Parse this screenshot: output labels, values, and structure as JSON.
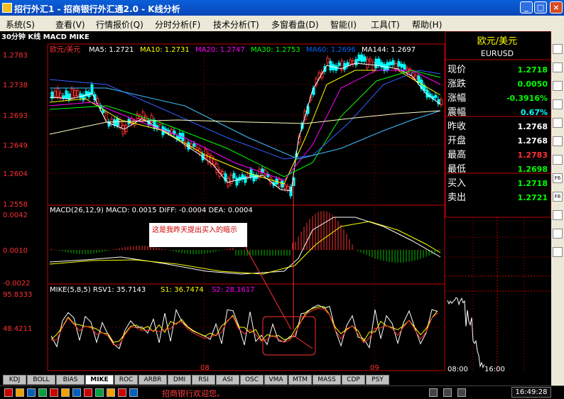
{
  "window": {
    "title": "招行外汇1 - 招商银行外汇通2.0 - K线分析",
    "controls": [
      "_",
      "□",
      "×"
    ]
  },
  "menu": [
    "系统(S)",
    "查看(V)",
    "行情报价(Q)",
    "分时分析(F)",
    "技术分析(T)",
    "多窗看盘(D)",
    "智能(I)",
    "工具(T)",
    "帮助(H)"
  ],
  "chart_header": "30分钟 K线 MACD MIKE",
  "main_chart": {
    "symbol": "欧元/美元",
    "ma": [
      {
        "label": "MA5: 1.2721",
        "color": "#ffffff"
      },
      {
        "label": "MA10: 1.2731",
        "color": "#ffff00"
      },
      {
        "label": "MA20: 1.2747",
        "color": "#ff00ff"
      },
      {
        "label": "MA30: 1.2753",
        "color": "#00ff00"
      },
      {
        "label": "MA60: 1.2696",
        "color": "#0066ff"
      },
      {
        "label": "MA144: 1.2697",
        "color": "#ffffff"
      }
    ],
    "y_ticks": [
      "1.2783",
      "1.2738",
      "1.2693",
      "1.2649",
      "1.2604",
      "1.2558"
    ]
  },
  "macd_chart": {
    "header": "MACD(26,12,9) MACD: 0.0015 DIFF: -0.0004 DEA: 0.0004",
    "y_ticks": [
      "0.0042",
      "0.0010",
      "-0.0022"
    ]
  },
  "mike_chart": {
    "header_items": [
      {
        "text": "MIKE(5,8,5) RSV1: 35.7143",
        "color": "#ffffff"
      },
      {
        "text": "S1: 36.7474",
        "color": "#ffff00"
      },
      {
        "text": "S2: 28.1617",
        "color": "#ff00ff"
      }
    ],
    "y_ticks": [
      "95.8333",
      "48.4211"
    ]
  },
  "x_labels": [
    "08",
    "09"
  ],
  "annotation": "这是我昨天提出买入的暗示",
  "quote_panel": {
    "name": "欧元/美元",
    "code": "EURUSD",
    "rows": [
      {
        "label": "现价",
        "value": "1.2718",
        "color": "#00ff00"
      },
      {
        "label": "涨跌",
        "value": "0.0050",
        "color": "#00ff00"
      },
      {
        "label": "涨幅",
        "value": "-0.3916%",
        "color": "#00ff00"
      },
      {
        "label": "震幅",
        "value": "0.67%",
        "color": "#00ffff"
      },
      {
        "label": "昨收",
        "value": "1.2768",
        "color": "#ffffff"
      },
      {
        "label": "开盘",
        "value": "1.2768",
        "color": "#ffffff"
      },
      {
        "label": "最高",
        "value": "1.2783",
        "color": "#ff3030"
      },
      {
        "label": "最低",
        "value": "1.2698",
        "color": "#00ff00"
      },
      {
        "label": "买入",
        "value": "1.2718",
        "color": "#00ff00"
      },
      {
        "label": "卖出",
        "value": "1.2721",
        "color": "#00ff00"
      }
    ],
    "time_labels": [
      "08:00",
      "16:00"
    ]
  },
  "tabs": [
    "KDJ",
    "BOLL",
    "BIAS",
    "MIKE",
    "ROC",
    "ARBR",
    "DMI",
    "RSI",
    "ASI",
    "OSC",
    "VMA",
    "MTM",
    "MASS",
    "CDP",
    "PSY"
  ],
  "active_tab": "MIKE",
  "status": {
    "message": "招商银行欢迎您。",
    "time": "16:49:28"
  },
  "side_tools": [
    "zoom-in",
    "zoom-out",
    "up",
    "down",
    "cross",
    "line-draw",
    "bar-chart",
    "f6",
    "f8",
    "export",
    "calc",
    "help"
  ]
}
